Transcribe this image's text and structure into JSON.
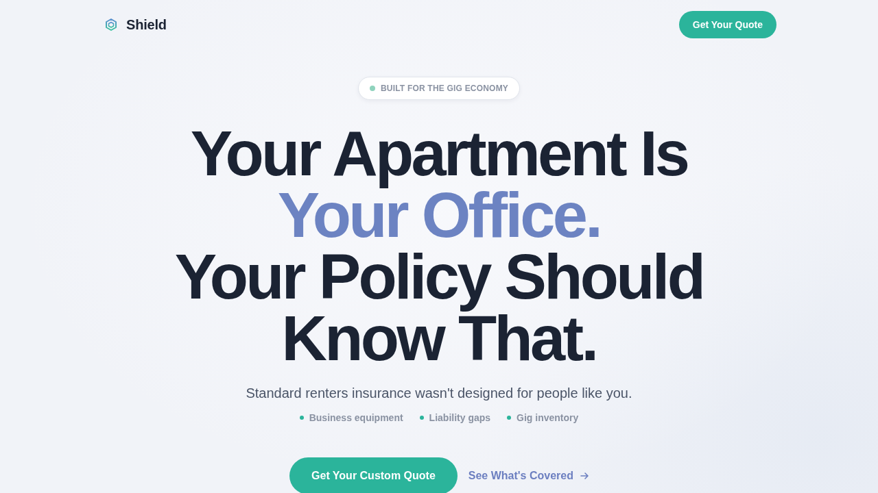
{
  "nav": {
    "logo": {
      "name": "Shield"
    },
    "cta": "Get Your Quote"
  },
  "hero": {
    "badge": {
      "text": "BUILT FOR THE GIG ECONOMY"
    },
    "headline": [
      {
        "text": "Your Apartment Is",
        "accent": false
      },
      {
        "text": "Your Office.",
        "accent": true
      },
      {
        "text": "Your Policy Should",
        "accent": false
      },
      {
        "text": "Know That.",
        "accent": false
      }
    ],
    "subtitle": "Standard renters insurance wasn't designed for people like you.",
    "features": [
      "Business equipment",
      "Liability gaps",
      "Gig inventory"
    ],
    "primary_button": "Get Your Custom Quote",
    "secondary_link": "See What's Covered"
  }
}
